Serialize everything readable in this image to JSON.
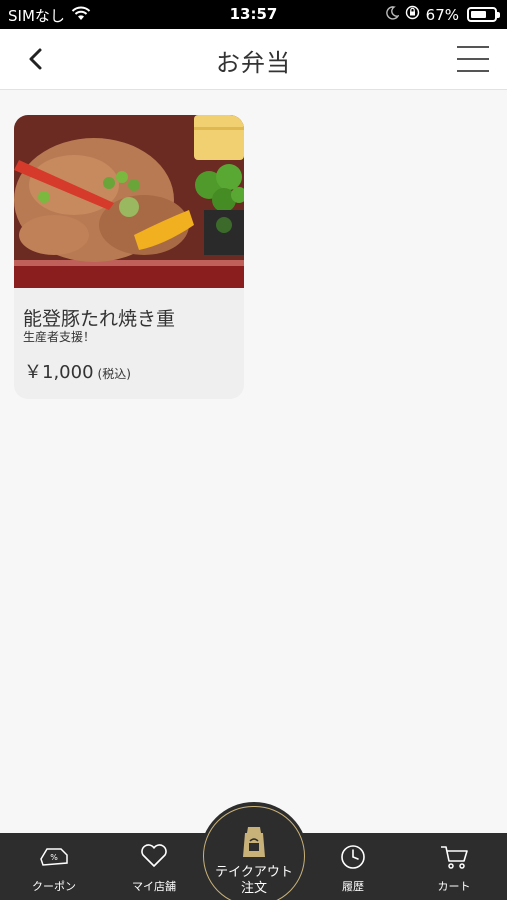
{
  "status_bar": {
    "carrier": "SIMなし",
    "time": "13:57",
    "battery_percent": "67%",
    "battery_level": 0.67,
    "icons": [
      "wifi-icon",
      "moon-icon",
      "orientation-lock-icon",
      "battery-icon"
    ]
  },
  "header": {
    "title": "お弁当",
    "icons": [
      "back-chevron-icon",
      "hamburger-menu-icon"
    ]
  },
  "products": [
    {
      "name": "能登豚たれ焼き重",
      "subtitle": "生産者支援！",
      "price": "￥1,000",
      "tax_note": "(税込)"
    }
  ],
  "tabbar": {
    "tabs": [
      {
        "label": "クーポン",
        "icon": "coupon-icon"
      },
      {
        "label": "マイ店舗",
        "icon": "heart-icon"
      },
      {
        "label": "テイクアウト\n注文",
        "icon": "takeout-bag-icon"
      },
      {
        "label": "履歴",
        "icon": "clock-icon"
      },
      {
        "label": "カート",
        "icon": "cart-icon"
      }
    ],
    "accent": "#c9b27a",
    "background": "#2d2d2d"
  }
}
